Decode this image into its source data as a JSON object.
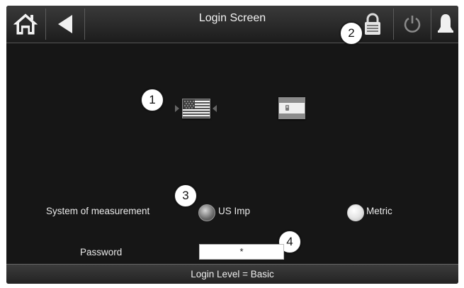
{
  "header": {
    "title": "Login Screen"
  },
  "callouts": [
    "1",
    "2",
    "3",
    "4"
  ],
  "language": {
    "options": [
      "english-us-flag",
      "spanish-flag"
    ],
    "selected": "english-us-flag"
  },
  "measurement": {
    "label": "System of measurement",
    "options": [
      {
        "label": "US Imp",
        "selected": true
      },
      {
        "label": "Metric",
        "selected": false
      }
    ]
  },
  "password": {
    "label": "Password",
    "value": "*"
  },
  "status": {
    "text": "Login Level = Basic"
  },
  "icons": {
    "home": "home-icon",
    "back": "back-arrow-icon",
    "lock": "lock-icon",
    "power": "power-icon",
    "alarm": "bell-icon"
  }
}
